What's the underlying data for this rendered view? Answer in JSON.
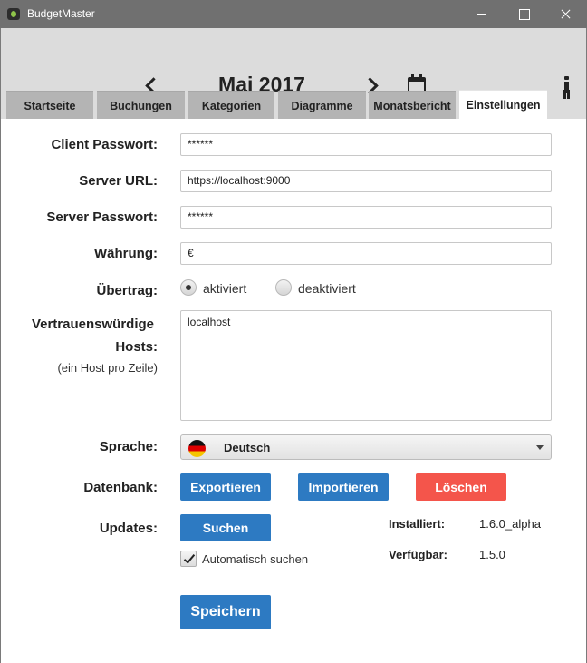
{
  "window": {
    "title": "BudgetMaster"
  },
  "header": {
    "month": "Mai 2017"
  },
  "tabs": [
    {
      "label": "Startseite"
    },
    {
      "label": "Buchungen"
    },
    {
      "label": "Kategorien"
    },
    {
      "label": "Diagramme"
    },
    {
      "label": "Monatsbericht"
    },
    {
      "label": "Einstellungen"
    }
  ],
  "settings": {
    "client_password": {
      "label": "Client Passwort:",
      "value": "******"
    },
    "server_url": {
      "label": "Server URL:",
      "value": "https://localhost:9000"
    },
    "server_password": {
      "label": "Server Passwort:",
      "value": "******"
    },
    "currency": {
      "label": "Währung:",
      "value": "€"
    },
    "carryover": {
      "label": "Übertrag:",
      "option_on": "aktiviert",
      "option_off": "deaktiviert",
      "selected": "aktiviert"
    },
    "trusted_hosts": {
      "label_line1": "Vertrauenswürdige",
      "label_line2": "Hosts:",
      "hint": "(ein Host pro Zeile)",
      "value": "localhost"
    },
    "language": {
      "label": "Sprache:",
      "value": "Deutsch",
      "flag": "germany-flag"
    },
    "database": {
      "label": "Datenbank:",
      "export_label": "Exportieren",
      "import_label": "Importieren",
      "delete_label": "Löschen"
    },
    "updates": {
      "label": "Updates:",
      "search_label": "Suchen",
      "auto_search_label": "Automatisch suchen",
      "auto_search_checked": true,
      "installed_label": "Installiert:",
      "installed_value": "1.6.0_alpha",
      "available_label": "Verfügbar:",
      "available_value": "1.5.0"
    },
    "save_label": "Speichern"
  },
  "colors": {
    "primary_button": "#2d7ac2",
    "danger_button": "#f4554b",
    "titlebar": "#707070",
    "header_bg": "#dcdcdc",
    "tab_bg": "#b4b4b4"
  }
}
